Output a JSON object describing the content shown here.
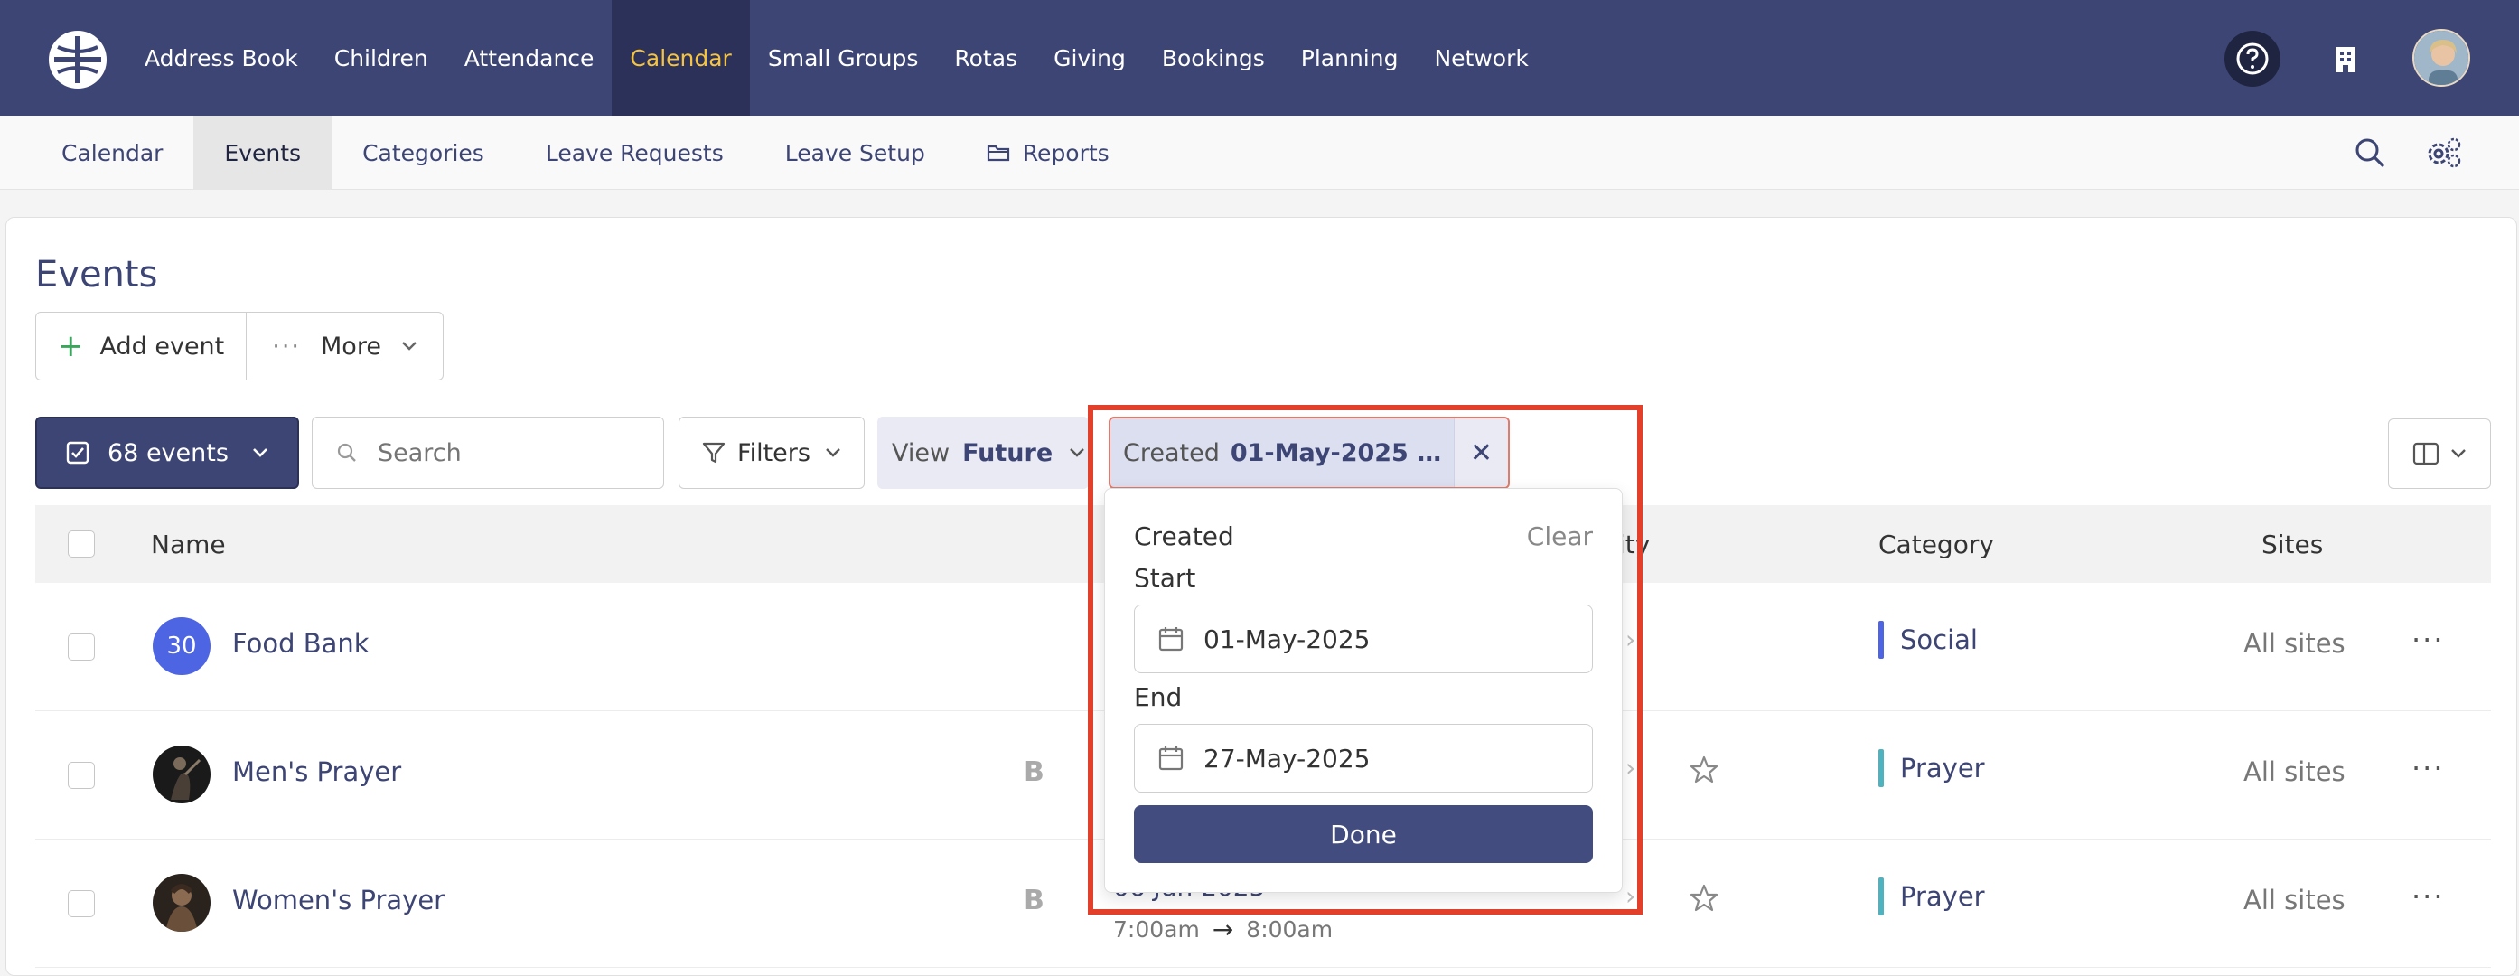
{
  "topnav": {
    "items": [
      {
        "label": "Address Book"
      },
      {
        "label": "Children"
      },
      {
        "label": "Attendance"
      },
      {
        "label": "Calendar",
        "active": true
      },
      {
        "label": "Small Groups"
      },
      {
        "label": "Rotas"
      },
      {
        "label": "Giving"
      },
      {
        "label": "Bookings"
      },
      {
        "label": "Planning"
      },
      {
        "label": "Network"
      }
    ],
    "icons": [
      "help-icon",
      "building-icon",
      "user-avatar"
    ]
  },
  "subnav": {
    "items": [
      {
        "label": "Calendar"
      },
      {
        "label": "Events",
        "active": true
      },
      {
        "label": "Categories"
      },
      {
        "label": "Leave Requests"
      },
      {
        "label": "Leave Setup"
      },
      {
        "label": "Reports",
        "icon": "folder-icon"
      }
    ]
  },
  "page": {
    "title": "Events",
    "add_label": "Add event",
    "more_label": "More"
  },
  "toolbar": {
    "events_count": "68 events",
    "search_placeholder": "Search",
    "filters_label": "Filters",
    "view_label": "View",
    "view_value": "Future",
    "created_label": "Created",
    "created_value": "01-May-2025 - 2..."
  },
  "table": {
    "headers": {
      "name": "Name",
      "activity_partial": "ity",
      "category": "Category",
      "sites": "Sites"
    },
    "rows": [
      {
        "name": "Food Bank",
        "avatar_text": "30",
        "category": "Social",
        "category_color": "#4d64e3",
        "sites": "All sites",
        "has_b": false,
        "has_star": false
      },
      {
        "name": "Men's Prayer",
        "category": "Prayer",
        "category_color": "#4fb3bf",
        "sites": "All sites",
        "has_b": true,
        "has_star": true
      },
      {
        "name": "Women's Prayer",
        "category": "Prayer",
        "category_color": "#4fb3bf",
        "sites": "All sites",
        "has_b": true,
        "has_star": true
      }
    ],
    "b_label": "B",
    "row3_date_partial": "06 Jun 2025",
    "row3_time_start": "7:00am",
    "row3_time_end": "8:00am"
  },
  "popover": {
    "title": "Created",
    "clear_label": "Clear",
    "start_label": "Start",
    "start_value": "01-May-2025",
    "end_label": "End",
    "end_value": "27-May-2025",
    "done_label": "Done"
  },
  "colors": {
    "nav_bg": "#3d4574",
    "nav_active_text": "#f5c343",
    "primary": "#3d4574",
    "highlight": "#e3402c"
  }
}
